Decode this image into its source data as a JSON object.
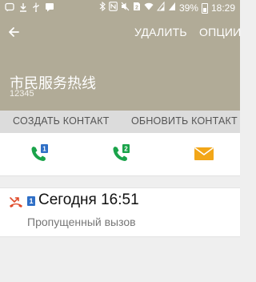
{
  "status_bar": {
    "battery": "39%",
    "time": "18:29"
  },
  "toolbar": {
    "delete_label": "УДАЛИТЬ",
    "options_label": "ОПЦИИ"
  },
  "contact": {
    "name": "市民服务热线",
    "number": "12345"
  },
  "contact_actions": {
    "create_label": "СОЗДАТЬ КОНТАКТ",
    "update_label": "ОБНОВИТЬ КОНТАКТ"
  },
  "quick_actions": {
    "sim1_badge": "1",
    "sim2_badge": "2",
    "call_color": "#1aa34a",
    "message_color": "#f2a618"
  },
  "history": {
    "sim_badge": "1",
    "time": "Сегодня 16:51",
    "type": "Пропущенный вызов",
    "missed_color": "#e04b2a"
  },
  "colors": {
    "header_bg": "#b1ab97",
    "sim_badge_bg": "#2f6fc6"
  }
}
